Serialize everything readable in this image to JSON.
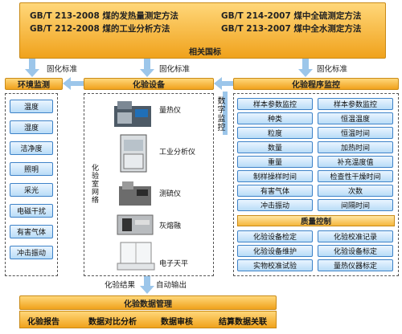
{
  "standards": {
    "line1_left": "GB/T 213-2008 煤的发热量测定方法",
    "line1_right": "GB/T 214-2007 煤中全硫测定方法",
    "line2_left": "GB/T 212-2008 煤的工业分析方法",
    "line2_right": "GB/T 213-2007 煤中全水测定方法",
    "title": "相关国标"
  },
  "arrows": {
    "fixed_std_1": "固化标准",
    "fixed_std_2": "固化标准",
    "fixed_std_3": "固化标准",
    "digital_monitor": "数字监控",
    "lab_result": "化验结果",
    "auto_output": "自动输出"
  },
  "env": {
    "title": "环境监测",
    "items": [
      "温度",
      "湿度",
      "洁净度",
      "照明",
      "采光",
      "电磁干扰",
      "有害气体",
      "冲击振动"
    ]
  },
  "equipment": {
    "title": "化验设备",
    "network_label": "化验室网络",
    "devices": [
      "量热仪",
      "工业分析仪",
      "测硫仪",
      "灰熔融",
      "电子天平"
    ]
  },
  "process": {
    "title": "化验程序监控",
    "params": [
      [
        "样本参数监控",
        "样本参数监控"
      ],
      [
        "种类",
        "恒温温度"
      ],
      [
        "粒度",
        "恒温时间"
      ],
      [
        "数量",
        "加热时间"
      ],
      [
        "重量",
        "补充温度值"
      ],
      [
        "制样操样时间",
        "检查性干燥时间"
      ],
      [
        "有害气体",
        "次数"
      ],
      [
        "冲击振动",
        "间隔时间"
      ]
    ],
    "quality_title": "质量控制",
    "quality": [
      [
        "化验设备检定",
        "化验校准记录"
      ],
      [
        "化验设备维护",
        "化验设备标定"
      ],
      [
        "实物校准试验",
        "量热仪器标定"
      ]
    ]
  },
  "data_mgmt": {
    "title": "化验数据管理",
    "items": [
      "化验报告",
      "数据对比分析",
      "数据审核",
      "结算数据关联"
    ]
  }
}
